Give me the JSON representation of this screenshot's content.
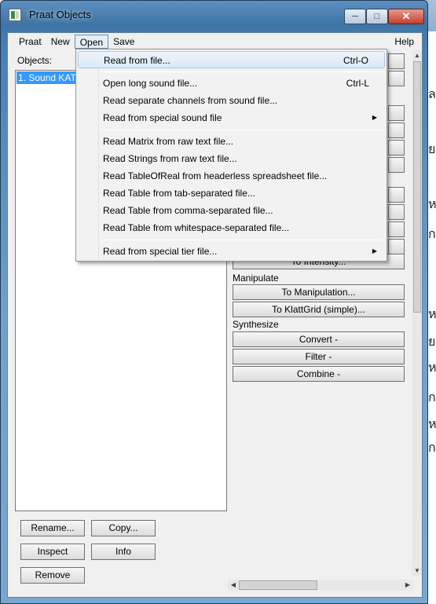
{
  "window": {
    "title": "Praat Objects"
  },
  "caption_buttons": {
    "minimize": "─",
    "maximize": "□",
    "close": "✕"
  },
  "menubar": {
    "items": [
      "Praat",
      "New",
      "Open",
      "Save"
    ],
    "help": "Help"
  },
  "objects": {
    "label": "Objects:",
    "items": [
      "1. Sound KATA"
    ]
  },
  "open_menu": {
    "items": [
      {
        "label": "Read from file...",
        "shortcut": "Ctrl-O",
        "submenu": false
      },
      {
        "label": "Open long sound file...",
        "shortcut": "Ctrl-L",
        "submenu": false
      },
      {
        "label": "Read separate channels from sound file...",
        "shortcut": "",
        "submenu": false
      },
      {
        "label": "Read from special sound file",
        "shortcut": "",
        "submenu": true
      },
      {
        "label": "Read Matrix from raw text file...",
        "shortcut": "",
        "submenu": false
      },
      {
        "label": "Read Strings from raw text file...",
        "shortcut": "",
        "submenu": false
      },
      {
        "label": "Read TableOfReal from headerless spreadsheet file...",
        "shortcut": "",
        "submenu": false
      },
      {
        "label": "Read Table from tab-separated file...",
        "shortcut": "",
        "submenu": false
      },
      {
        "label": "Read Table from comma-separated file...",
        "shortcut": "",
        "submenu": false
      },
      {
        "label": "Read Table from whitespace-separated file...",
        "shortcut": "",
        "submenu": false
      },
      {
        "label": "Read from special tier file...",
        "shortcut": "",
        "submenu": true
      }
    ],
    "submenu_icon": "triangle-right-icon"
  },
  "actions": {
    "partial_button": "To Intensity...",
    "manipulate_label": "Manipulate",
    "manipulate_buttons": [
      "To Manipulation...",
      "To KlattGrid (simple)..."
    ],
    "synthesize_label": "Synthesize",
    "synthesize_buttons": [
      "Convert -",
      "Filter -",
      "Combine -"
    ]
  },
  "object_buttons": {
    "rename": "Rename...",
    "copy": "Copy...",
    "inspect": "Inspect",
    "info": "Info",
    "remove": "Remove"
  },
  "scroll_arrows": {
    "up": "▲",
    "down": "▼",
    "left": "◀",
    "right": "▶"
  },
  "background_glyphs": [
    "ล",
    "ย",
    "ห",
    "ก",
    "ห",
    "ย",
    "ห",
    "ก",
    "ห",
    "ก",
    "ห"
  ]
}
